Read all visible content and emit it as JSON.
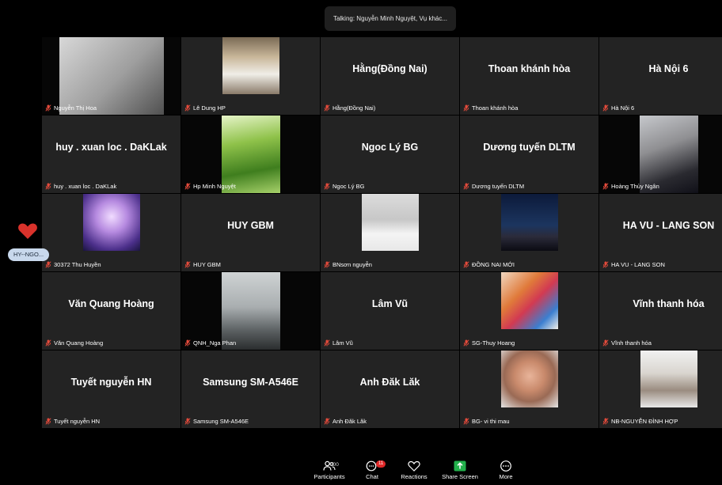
{
  "talking_banner": "Talking: Nguyễn Minh Nguyệt, Vụ khác...",
  "tiles": [
    {
      "label": "Nguyễn Thị Hoa",
      "name": "",
      "photo": "video-gray"
    },
    {
      "label": "Lê Dung HP",
      "name": "",
      "photo": "group-photo"
    },
    {
      "label": "Hằng(Đồng Nai)",
      "name": "Hằng(Đồng Nai)"
    },
    {
      "label": "Thoan khánh hòa",
      "name": "Thoan khánh hòa"
    },
    {
      "label": "Hà Nội 6",
      "name": "Hà Nội 6"
    },
    {
      "label": "huy . xuan loc . DaKLak",
      "name": "huy . xuan loc . DaKLak"
    },
    {
      "label": "Hp Minh Nguyệt",
      "name": "",
      "photo": "grass"
    },
    {
      "label": "Ngoc Lý BG",
      "name": "Ngoc Lý BG"
    },
    {
      "label": "Dương tuyến DLTM",
      "name": "Dương tuyến DLTM"
    },
    {
      "label": "Hoàng Thủy Ngân",
      "name": "",
      "photo": "person-dark"
    },
    {
      "label": "30372 Thu Huyền",
      "name": "",
      "photo": "fairy"
    },
    {
      "label": "HUY GBM",
      "name": "HUY GBM"
    },
    {
      "label": "BNsơn nguyễn",
      "name": "",
      "photo": "man-white-shirt"
    },
    {
      "label": "ĐỒNG NAI MỚI",
      "name": "",
      "photo": "night-sky"
    },
    {
      "label": "HA VU - LANG SON",
      "name": "HA VU - LANG SON"
    },
    {
      "label": "Văn Quang Hoàng",
      "name": "Văn Quang Hoàng"
    },
    {
      "label": "QNH_Nga Phan",
      "name": "",
      "photo": "room-video"
    },
    {
      "label": "Lâm Vũ",
      "name": "Lâm Vũ"
    },
    {
      "label": "SG-Thuy Hoang",
      "name": "",
      "photo": "flowers"
    },
    {
      "label": "Vĩnh thanh hóa",
      "name": "Vĩnh thanh hóa"
    },
    {
      "label": "Tuyết nguyễn HN",
      "name": "Tuyết nguyễn HN"
    },
    {
      "label": "Samsung SM-A546E",
      "name": "Samsung SM-A546E"
    },
    {
      "label": "Anh Đăk Lăk",
      "name": "Anh Đăk Lăk"
    },
    {
      "label": "BG- vi thi mau",
      "name": "",
      "photo": "woman-face"
    },
    {
      "label": "NB-NGUYỄN ĐÌNH HỢP",
      "name": "",
      "photo": "elder-man"
    }
  ],
  "side": {
    "pill": "HY--NGO..."
  },
  "toolbar": {
    "participants_label": "Participants",
    "participants_count": "300",
    "chat_label": "Chat",
    "chat_badge": "11",
    "reactions_label": "Reactions",
    "share_label": "Share Screen",
    "more_label": "More"
  },
  "colors": {
    "tile_bg": "#232323",
    "share_green": "#22b04b",
    "mic_muted": "#e24a3b",
    "heart": "#d9322b"
  }
}
